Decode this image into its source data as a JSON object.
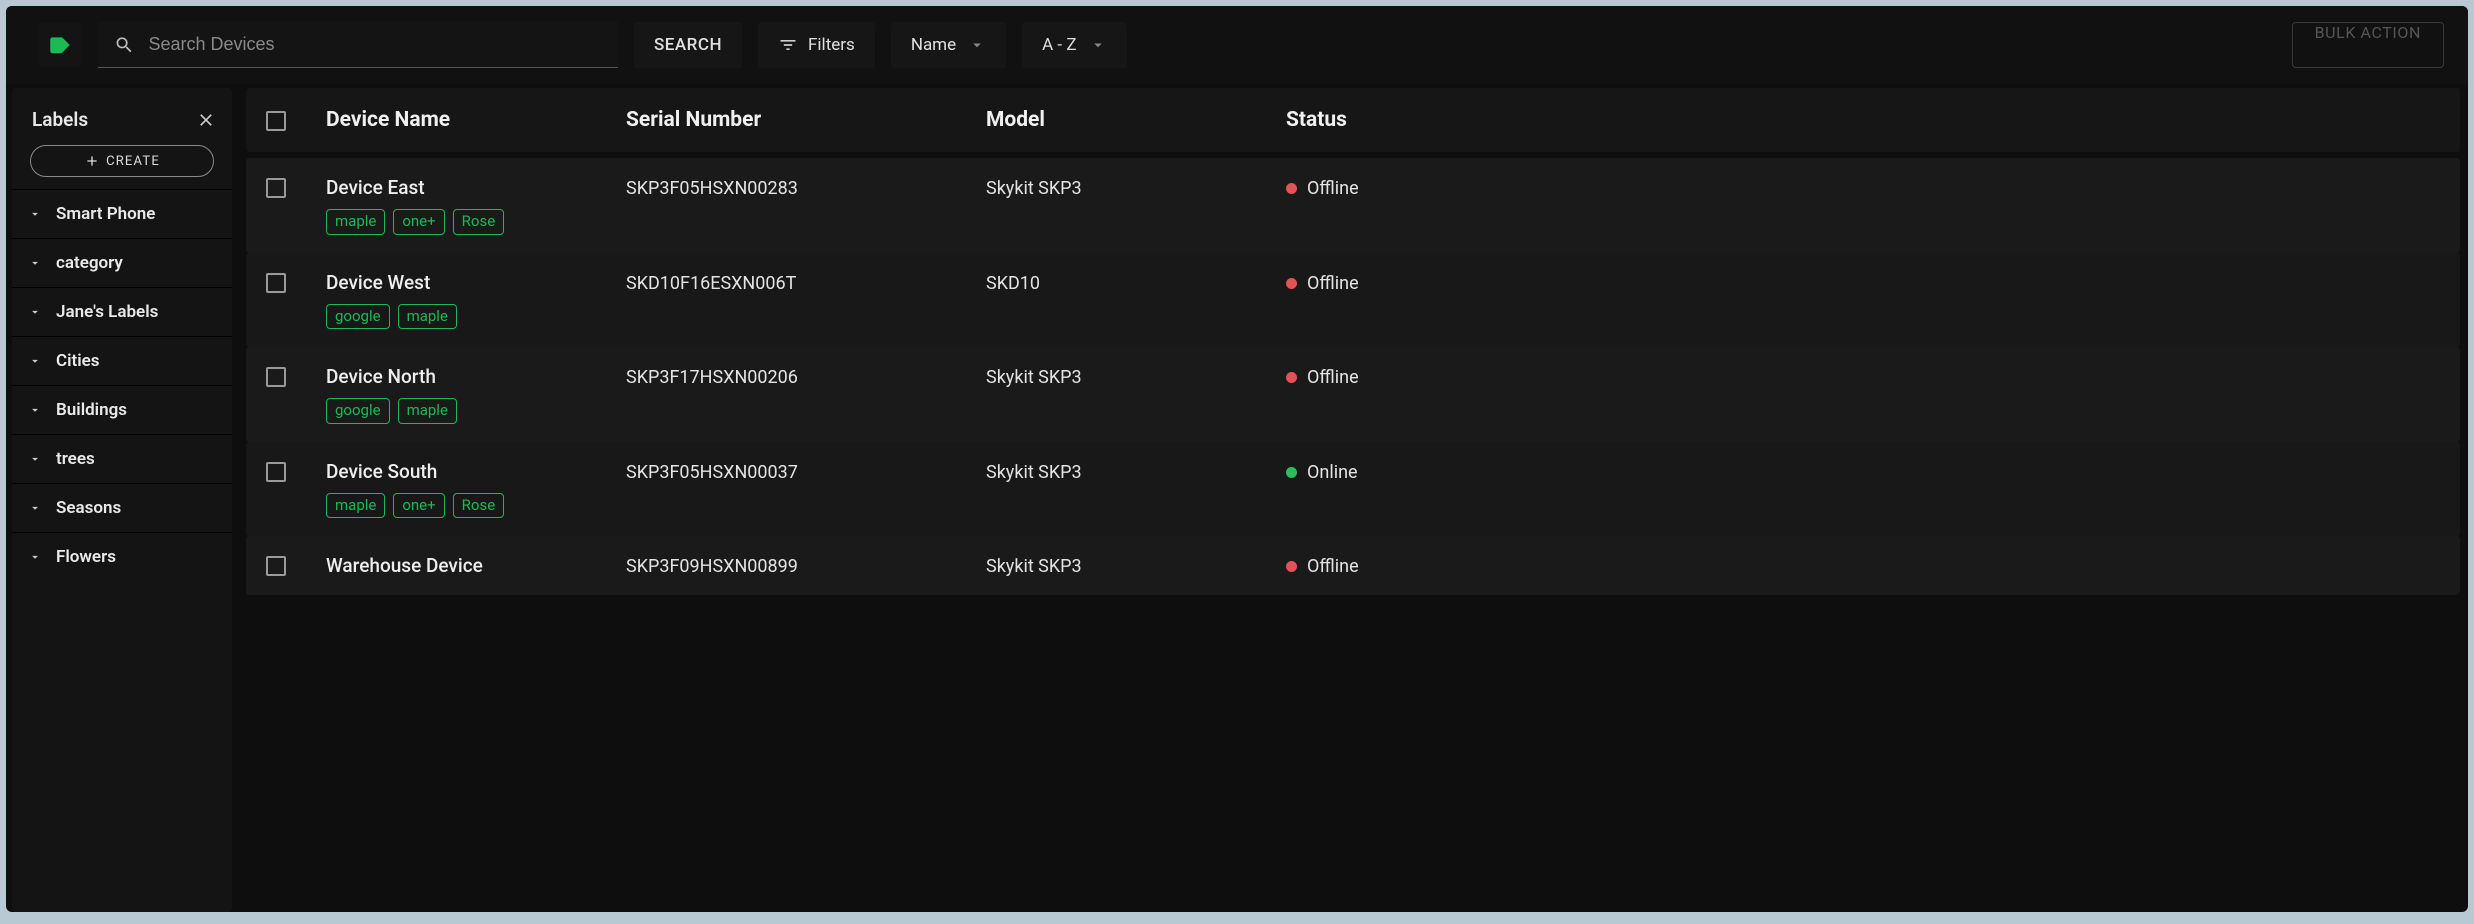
{
  "topbar": {
    "search_placeholder": "Search Devices",
    "search_button": "SEARCH",
    "filters_button": "Filters",
    "sort_field": "Name",
    "sort_order": "A - Z",
    "bulk_action": "BULK ACTION"
  },
  "sidebar": {
    "title": "Labels",
    "create_label": "CREATE",
    "groups": [
      {
        "label": "Smart Phone"
      },
      {
        "label": "category"
      },
      {
        "label": "Jane's Labels"
      },
      {
        "label": "Cities"
      },
      {
        "label": "Buildings"
      },
      {
        "label": "trees"
      },
      {
        "label": "Seasons"
      },
      {
        "label": "Flowers"
      }
    ]
  },
  "table": {
    "headers": {
      "name": "Device Name",
      "serial": "Serial Number",
      "model": "Model",
      "status": "Status"
    }
  },
  "colors": {
    "accent_green": "#1db954",
    "status_offline": "#e35255",
    "status_online": "#2bbf5a"
  },
  "devices": [
    {
      "name": "Device East",
      "serial": "SKP3F05HSXN00283",
      "model": "Skykit SKP3",
      "status": "Offline",
      "status_color": "#e35255",
      "labels": [
        "maple",
        "one+",
        "Rose"
      ]
    },
    {
      "name": "Device West",
      "serial": "SKD10F16ESXN006T",
      "model": "SKD10",
      "status": "Offline",
      "status_color": "#e35255",
      "labels": [
        "google",
        "maple"
      ]
    },
    {
      "name": "Device North",
      "serial": "SKP3F17HSXN00206",
      "model": "Skykit SKP3",
      "status": "Offline",
      "status_color": "#e35255",
      "labels": [
        "google",
        "maple"
      ]
    },
    {
      "name": "Device South",
      "serial": "SKP3F05HSXN00037",
      "model": "Skykit SKP3",
      "status": "Online",
      "status_color": "#2bbf5a",
      "labels": [
        "maple",
        "one+",
        "Rose"
      ]
    },
    {
      "name": "Warehouse Device",
      "serial": "SKP3F09HSXN00899",
      "model": "Skykit SKP3",
      "status": "Offline",
      "status_color": "#e35255",
      "labels": []
    }
  ]
}
